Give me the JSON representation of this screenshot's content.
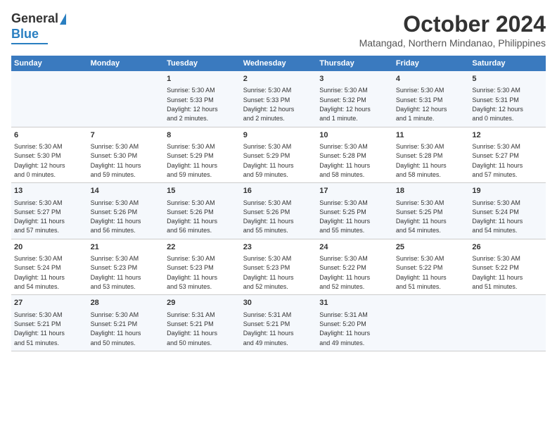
{
  "logo": {
    "text1": "General",
    "text2": "Blue"
  },
  "title": "October 2024",
  "location": "Matangad, Northern Mindanao, Philippines",
  "days_header": [
    "Sunday",
    "Monday",
    "Tuesday",
    "Wednesday",
    "Thursday",
    "Friday",
    "Saturday"
  ],
  "weeks": [
    [
      {
        "day": "",
        "info": ""
      },
      {
        "day": "",
        "info": ""
      },
      {
        "day": "1",
        "info": "Sunrise: 5:30 AM\nSunset: 5:33 PM\nDaylight: 12 hours\nand 2 minutes."
      },
      {
        "day": "2",
        "info": "Sunrise: 5:30 AM\nSunset: 5:33 PM\nDaylight: 12 hours\nand 2 minutes."
      },
      {
        "day": "3",
        "info": "Sunrise: 5:30 AM\nSunset: 5:32 PM\nDaylight: 12 hours\nand 1 minute."
      },
      {
        "day": "4",
        "info": "Sunrise: 5:30 AM\nSunset: 5:31 PM\nDaylight: 12 hours\nand 1 minute."
      },
      {
        "day": "5",
        "info": "Sunrise: 5:30 AM\nSunset: 5:31 PM\nDaylight: 12 hours\nand 0 minutes."
      }
    ],
    [
      {
        "day": "6",
        "info": "Sunrise: 5:30 AM\nSunset: 5:30 PM\nDaylight: 12 hours\nand 0 minutes."
      },
      {
        "day": "7",
        "info": "Sunrise: 5:30 AM\nSunset: 5:30 PM\nDaylight: 11 hours\nand 59 minutes."
      },
      {
        "day": "8",
        "info": "Sunrise: 5:30 AM\nSunset: 5:29 PM\nDaylight: 11 hours\nand 59 minutes."
      },
      {
        "day": "9",
        "info": "Sunrise: 5:30 AM\nSunset: 5:29 PM\nDaylight: 11 hours\nand 59 minutes."
      },
      {
        "day": "10",
        "info": "Sunrise: 5:30 AM\nSunset: 5:28 PM\nDaylight: 11 hours\nand 58 minutes."
      },
      {
        "day": "11",
        "info": "Sunrise: 5:30 AM\nSunset: 5:28 PM\nDaylight: 11 hours\nand 58 minutes."
      },
      {
        "day": "12",
        "info": "Sunrise: 5:30 AM\nSunset: 5:27 PM\nDaylight: 11 hours\nand 57 minutes."
      }
    ],
    [
      {
        "day": "13",
        "info": "Sunrise: 5:30 AM\nSunset: 5:27 PM\nDaylight: 11 hours\nand 57 minutes."
      },
      {
        "day": "14",
        "info": "Sunrise: 5:30 AM\nSunset: 5:26 PM\nDaylight: 11 hours\nand 56 minutes."
      },
      {
        "day": "15",
        "info": "Sunrise: 5:30 AM\nSunset: 5:26 PM\nDaylight: 11 hours\nand 56 minutes."
      },
      {
        "day": "16",
        "info": "Sunrise: 5:30 AM\nSunset: 5:26 PM\nDaylight: 11 hours\nand 55 minutes."
      },
      {
        "day": "17",
        "info": "Sunrise: 5:30 AM\nSunset: 5:25 PM\nDaylight: 11 hours\nand 55 minutes."
      },
      {
        "day": "18",
        "info": "Sunrise: 5:30 AM\nSunset: 5:25 PM\nDaylight: 11 hours\nand 54 minutes."
      },
      {
        "day": "19",
        "info": "Sunrise: 5:30 AM\nSunset: 5:24 PM\nDaylight: 11 hours\nand 54 minutes."
      }
    ],
    [
      {
        "day": "20",
        "info": "Sunrise: 5:30 AM\nSunset: 5:24 PM\nDaylight: 11 hours\nand 54 minutes."
      },
      {
        "day": "21",
        "info": "Sunrise: 5:30 AM\nSunset: 5:23 PM\nDaylight: 11 hours\nand 53 minutes."
      },
      {
        "day": "22",
        "info": "Sunrise: 5:30 AM\nSunset: 5:23 PM\nDaylight: 11 hours\nand 53 minutes."
      },
      {
        "day": "23",
        "info": "Sunrise: 5:30 AM\nSunset: 5:23 PM\nDaylight: 11 hours\nand 52 minutes."
      },
      {
        "day": "24",
        "info": "Sunrise: 5:30 AM\nSunset: 5:22 PM\nDaylight: 11 hours\nand 52 minutes."
      },
      {
        "day": "25",
        "info": "Sunrise: 5:30 AM\nSunset: 5:22 PM\nDaylight: 11 hours\nand 51 minutes."
      },
      {
        "day": "26",
        "info": "Sunrise: 5:30 AM\nSunset: 5:22 PM\nDaylight: 11 hours\nand 51 minutes."
      }
    ],
    [
      {
        "day": "27",
        "info": "Sunrise: 5:30 AM\nSunset: 5:21 PM\nDaylight: 11 hours\nand 51 minutes."
      },
      {
        "day": "28",
        "info": "Sunrise: 5:30 AM\nSunset: 5:21 PM\nDaylight: 11 hours\nand 50 minutes."
      },
      {
        "day": "29",
        "info": "Sunrise: 5:31 AM\nSunset: 5:21 PM\nDaylight: 11 hours\nand 50 minutes."
      },
      {
        "day": "30",
        "info": "Sunrise: 5:31 AM\nSunset: 5:21 PM\nDaylight: 11 hours\nand 49 minutes."
      },
      {
        "day": "31",
        "info": "Sunrise: 5:31 AM\nSunset: 5:20 PM\nDaylight: 11 hours\nand 49 minutes."
      },
      {
        "day": "",
        "info": ""
      },
      {
        "day": "",
        "info": ""
      }
    ]
  ]
}
